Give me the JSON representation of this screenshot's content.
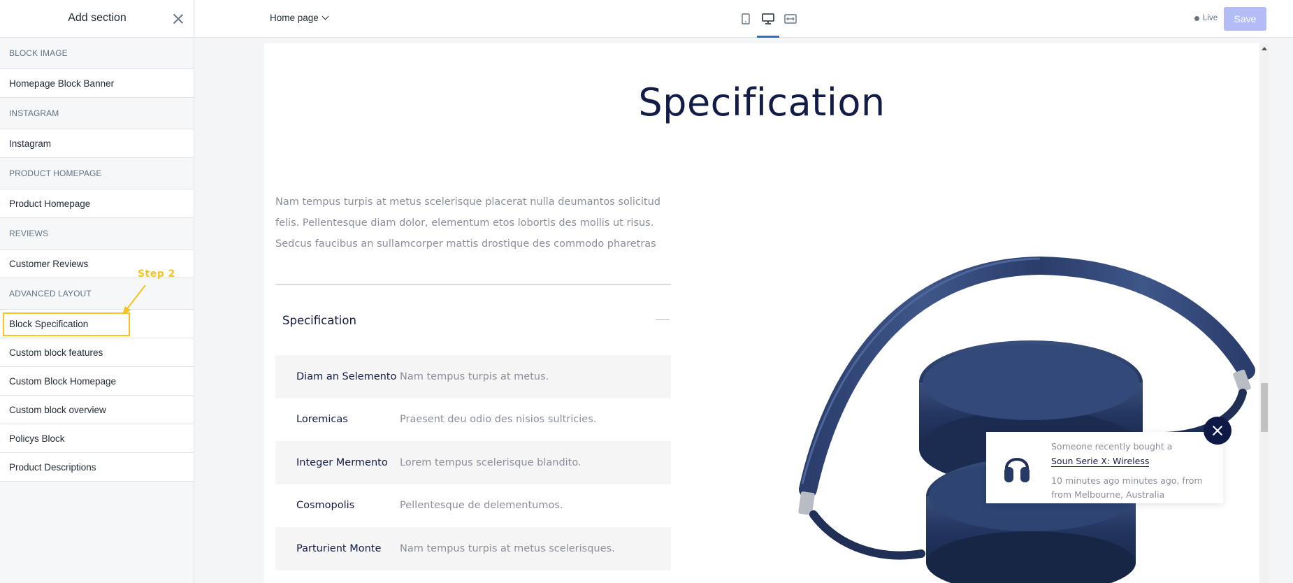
{
  "sidebar": {
    "title": "Add section",
    "groups": [
      {
        "label": "BLOCK IMAGE",
        "items": [
          "Homepage Block Banner"
        ]
      },
      {
        "label": "INSTAGRAM",
        "items": [
          "Instagram"
        ]
      },
      {
        "label": "PRODUCT HOMEPAGE",
        "items": [
          "Product Homepage"
        ]
      },
      {
        "label": "REVIEWS",
        "items": [
          "Customer Reviews"
        ]
      },
      {
        "label": "ADVANCED LAYOUT",
        "items": [
          "Block Specification",
          "Custom block features",
          "Custom Block Homepage",
          "Custom block overview",
          "Policys Block",
          "Product Descriptions"
        ]
      }
    ],
    "annotation": "Step 2"
  },
  "topbar": {
    "page": "Home page",
    "live": "Live",
    "save": "Save"
  },
  "preview": {
    "title": "Specification",
    "description": "Nam tempus turpis at metus scelerisque placerat nulla deumantos solicitud felis. Pellentesque diam dolor, elementum etos lobortis des mollis ut risus. Sedcus faucibus an sullamcorper mattis drostique des commodo pharetras",
    "accordion_title": "Specification",
    "specs": [
      {
        "key": "Diam an Selemento",
        "value": "Nam tempus turpis at metus."
      },
      {
        "key": "Loremicas",
        "value": "Praesent deu odio des nisios sultricies."
      },
      {
        "key": "Integer Mermento",
        "value": "Lorem tempus scelerisque blandito."
      },
      {
        "key": "Cosmopolis",
        "value": "Pellentesque de delementumos."
      },
      {
        "key": "Parturient Monte",
        "value": "Nam tempus turpis at metus scelerisques."
      }
    ]
  },
  "toast": {
    "line1": "Someone recently bought a",
    "product": "Soun Serie X: Wireless",
    "line2": "10 minutes ago minutes ago, from from Melbourne, Australia"
  },
  "colors": {
    "accent": "#2c6ecb",
    "highlight": "#f7c320",
    "navy": "#131c47",
    "save_disabled": "#b3bcf5"
  }
}
